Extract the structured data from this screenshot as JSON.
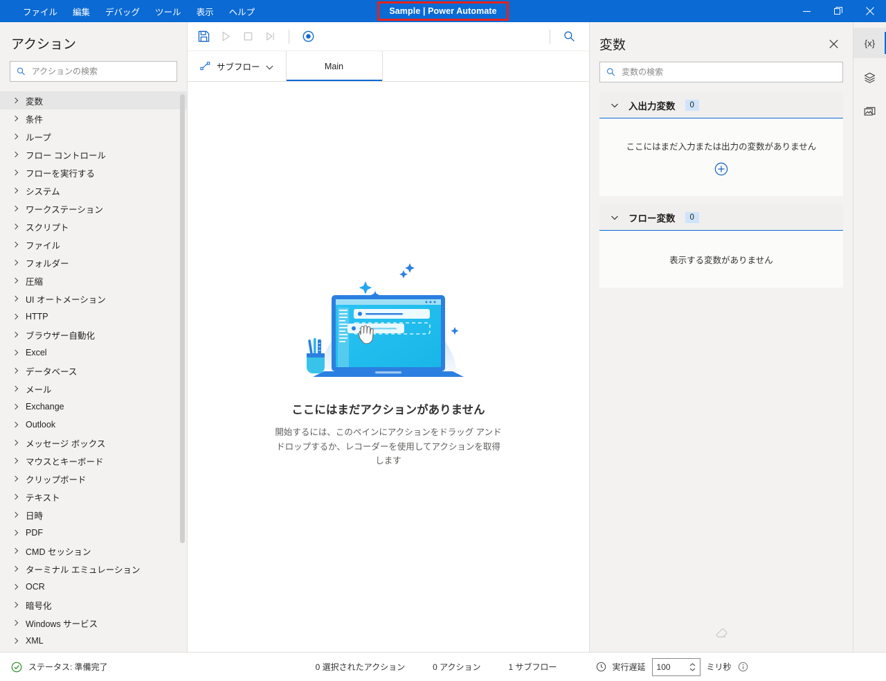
{
  "titlebar": {
    "menu": [
      {
        "label": "ファイル",
        "name": "menu-file"
      },
      {
        "label": "編集",
        "name": "menu-edit"
      },
      {
        "label": "デバッグ",
        "name": "menu-debug"
      },
      {
        "label": "ツール",
        "name": "menu-tools"
      },
      {
        "label": "表示",
        "name": "menu-view"
      },
      {
        "label": "ヘルプ",
        "name": "menu-help"
      }
    ],
    "document_title": "Sample | Power Automate",
    "title_highlight_color": "#e8221a",
    "background_color": "#0b6ad4",
    "minimize_label": "最小化",
    "restore_label": "元に戻す",
    "close_label": "閉じる"
  },
  "actions_pane": {
    "title": "アクション",
    "search_placeholder": "アクションの検索",
    "search_value": "",
    "items": [
      {
        "label": "変数",
        "selected": true
      },
      {
        "label": "条件",
        "selected": false
      },
      {
        "label": "ループ",
        "selected": false
      },
      {
        "label": "フロー コントロール",
        "selected": false
      },
      {
        "label": "フローを実行する",
        "selected": false
      },
      {
        "label": "システム",
        "selected": false
      },
      {
        "label": "ワークステーション",
        "selected": false
      },
      {
        "label": "スクリプト",
        "selected": false
      },
      {
        "label": "ファイル",
        "selected": false
      },
      {
        "label": "フォルダー",
        "selected": false
      },
      {
        "label": "圧縮",
        "selected": false
      },
      {
        "label": "UI オートメーション",
        "selected": false
      },
      {
        "label": "HTTP",
        "selected": false
      },
      {
        "label": "ブラウザー自動化",
        "selected": false
      },
      {
        "label": "Excel",
        "selected": false
      },
      {
        "label": "データベース",
        "selected": false
      },
      {
        "label": "メール",
        "selected": false
      },
      {
        "label": "Exchange",
        "selected": false
      },
      {
        "label": "Outlook",
        "selected": false
      },
      {
        "label": "メッセージ ボックス",
        "selected": false
      },
      {
        "label": "マウスとキーボード",
        "selected": false
      },
      {
        "label": "クリップボード",
        "selected": false
      },
      {
        "label": "テキスト",
        "selected": false
      },
      {
        "label": "日時",
        "selected": false
      },
      {
        "label": "PDF",
        "selected": false
      },
      {
        "label": "CMD セッション",
        "selected": false
      },
      {
        "label": "ターミナル エミュレーション",
        "selected": false
      },
      {
        "label": "OCR",
        "selected": false
      },
      {
        "label": "暗号化",
        "selected": false
      },
      {
        "label": "Windows サービス",
        "selected": false
      },
      {
        "label": "XML",
        "selected": false
      }
    ]
  },
  "toolbar": {
    "save_label": "保存",
    "run_label": "実行",
    "stop_label": "停止",
    "step_label": "次のアクションを実行",
    "recorder_label": "レコーダー",
    "search_label": "検索"
  },
  "tabstrip": {
    "subflow_label": "サブフロー",
    "tabs": [
      {
        "label": "Main",
        "active": true
      }
    ]
  },
  "canvas": {
    "empty_title": "ここにはまだアクションがありません",
    "empty_subtitle": "開始するには、このペインにアクションをドラッグ アンド ドロップするか、レコーダーを使用してアクションを取得します"
  },
  "variables_pane": {
    "title": "変数",
    "search_placeholder": "変数の検索",
    "search_value": "",
    "close_label": "閉じる",
    "groups": [
      {
        "name": "入出力変数",
        "count": "0",
        "message": "ここにはまだ入力または出力の変数がありません",
        "has_add": true
      },
      {
        "name": "フロー変数",
        "count": "0",
        "message": "表示する変数がありません",
        "has_add": false
      }
    ],
    "accent_color": "#0b6ad4",
    "count_badge_color": "#cfe4fa"
  },
  "rail": {
    "items": [
      {
        "icon": "variables-icon",
        "glyph": "{x}",
        "active": true
      },
      {
        "icon": "ui-elements-icon",
        "glyph": "",
        "active": false
      },
      {
        "icon": "images-icon",
        "glyph": "",
        "active": false
      }
    ]
  },
  "statusbar": {
    "status_label": "ステータス: 準備完了",
    "selected_actions": "0 選択されたアクション",
    "actions_count": "0 アクション",
    "subflows_count": "1 サブフロー",
    "delay_label": "実行遅延",
    "delay_value": "100",
    "delay_unit": "ミリ秒",
    "status_ok_color": "#107c10"
  }
}
